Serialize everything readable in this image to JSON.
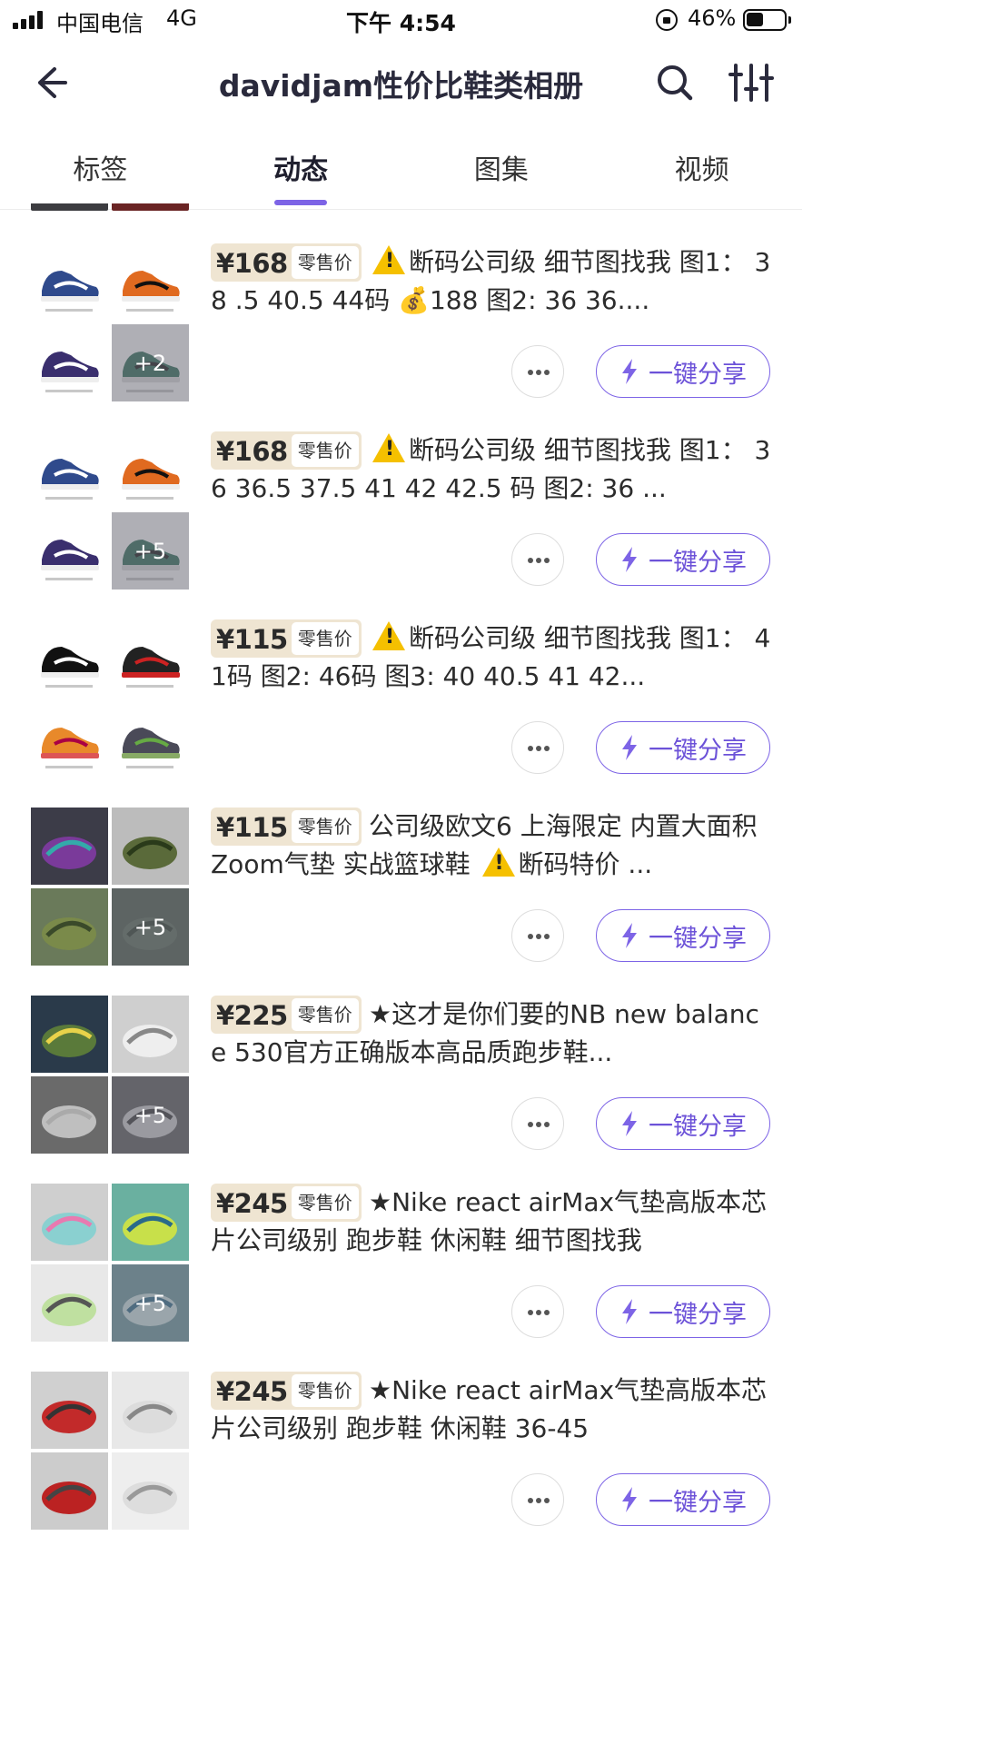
{
  "status_bar": {
    "carrier": "中国电信",
    "network": "4G",
    "time": "下午 4:54",
    "battery_percent": "46%",
    "battery_level": 0.46
  },
  "nav": {
    "title": "davidjam性价比鞋类相册",
    "back_icon": "back-arrow-icon",
    "search_icon": "search-icon",
    "filter_icon": "filter-sliders-icon"
  },
  "tabs": [
    {
      "label": "标签",
      "active": false
    },
    {
      "label": "动态",
      "active": true
    },
    {
      "label": "图集",
      "active": false
    },
    {
      "label": "视频",
      "active": false
    }
  ],
  "accent_color": "#7d64e6",
  "price_label": "零售价",
  "share_label": "一键分享",
  "items": [
    {
      "price": "¥168",
      "text_before": "",
      "has_warning": true,
      "text_after": "断码公司级 细节图找我 图1： 38 .5 40.5 44码 💰188 图2: 36 36....",
      "more_count": "+2",
      "thumb_style": "shoes-white"
    },
    {
      "price": "¥168",
      "text_before": "",
      "has_warning": true,
      "text_after": "断码公司级 细节图找我 图1： 36 36.5 37.5 41 42 42.5 码 图2: 36 ...",
      "more_count": "+5",
      "thumb_style": "shoes-white"
    },
    {
      "price": "¥115",
      "text_before": "",
      "has_warning": true,
      "text_after": "断码公司级 细节图找我 图1： 41码 图2: 46码 图3: 40 40.5 41 42...",
      "more_count": "",
      "thumb_style": "shoes-kyrie"
    },
    {
      "price": "¥115",
      "text_before": "公司级欧文6 上海限定 内置大面积 Zoom气垫 实战篮球鞋 ",
      "has_warning": true,
      "text_after": "断码特价 ...",
      "more_count": "+5",
      "thumb_style": "photo-green"
    },
    {
      "price": "¥225",
      "text_before": "★这才是你们要的NB new balance 530官方正确版本高品质跑步鞋...",
      "has_warning": false,
      "text_after": "",
      "more_count": "+5",
      "thumb_style": "photo-grey"
    },
    {
      "price": "¥245",
      "text_before": "★Nike react airMax气垫高版本芯片公司级别 跑步鞋 休闲鞋 细节图找我",
      "has_warning": false,
      "text_after": "",
      "more_count": "+5",
      "thumb_style": "photo-teal"
    },
    {
      "price": "¥245",
      "text_before": "★Nike react airMax气垫高版本芯片公司级别 跑步鞋 休闲鞋 36-45",
      "has_warning": false,
      "text_after": "",
      "more_count": "",
      "thumb_style": "photo-red"
    }
  ]
}
